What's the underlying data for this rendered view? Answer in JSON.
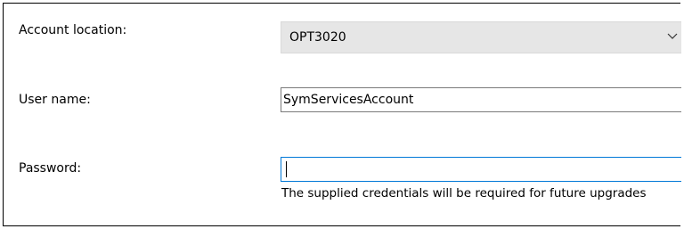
{
  "form": {
    "account_location": {
      "label": "Account location:",
      "selected": "OPT3020"
    },
    "user_name": {
      "label": "User name:",
      "value": "SymServicesAccount"
    },
    "password": {
      "label": "Password:",
      "value": "",
      "hint": "The supplied credentials will be required for future upgrades"
    }
  },
  "colors": {
    "combo_background": "#e6e6e6",
    "focus_border": "#0078d7",
    "input_border": "#7a7a7a"
  },
  "icons": {
    "dropdown": "chevron-down-icon"
  }
}
